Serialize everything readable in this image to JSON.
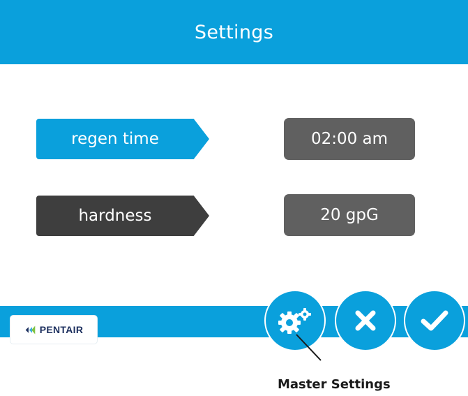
{
  "header": {
    "title": "Settings"
  },
  "settings": [
    {
      "label": "regen time",
      "value": "02:00 am"
    },
    {
      "label": "hardness",
      "value": "20 gpG"
    }
  ],
  "footer": {
    "brand": "PENTAIR",
    "buttons": {
      "master": "gear-icon",
      "cancel": "close-icon",
      "confirm": "check-icon"
    }
  },
  "annotation": {
    "caption": "Master Settings"
  },
  "colors": {
    "accent": "#0aa0dc",
    "tag_dark": "#3e3e3e",
    "value_bg": "#606060",
    "text_light": "#ffffff"
  }
}
